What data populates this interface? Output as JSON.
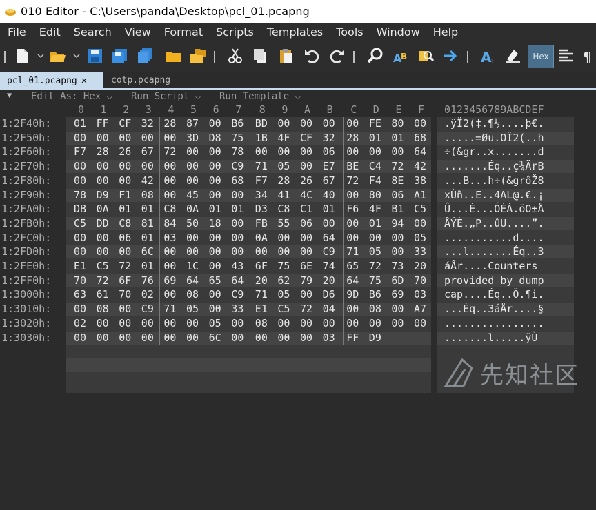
{
  "window": {
    "title": "010 Editor - C:\\Users\\panda\\Desktop\\pcl_01.pcapng"
  },
  "menu": [
    "File",
    "Edit",
    "Search",
    "View",
    "Format",
    "Scripts",
    "Templates",
    "Tools",
    "Window",
    "Help"
  ],
  "toolbar": {
    "hex_label": "Hex"
  },
  "tabs": [
    {
      "label": "pcl_01.pcapng",
      "close": "✕",
      "active": true
    },
    {
      "label": "cotp.pcapng",
      "active": false
    }
  ],
  "editbar": {
    "edit_as": "Edit As: Hex",
    "run_script": "Run Script",
    "run_template": "Run Template"
  },
  "columns": {
    "hex": [
      "0",
      "1",
      "2",
      "3",
      "4",
      "5",
      "6",
      "7",
      "8",
      "9",
      "A",
      "B",
      "C",
      "D",
      "E",
      "F"
    ],
    "text": "0123456789ABCDEF"
  },
  "rows": [
    {
      "addr": "1:2F40h:",
      "bytes": [
        "01",
        "FF",
        "CF",
        "32",
        "28",
        "87",
        "00",
        "B6",
        "BD",
        "00",
        "00",
        "00",
        "00",
        "FE",
        "80",
        "00"
      ],
      "text": ".ÿÏ2(‡.¶½....þ€."
    },
    {
      "addr": "1:2F50h:",
      "bytes": [
        "00",
        "00",
        "00",
        "00",
        "00",
        "3D",
        "D8",
        "75",
        "1B",
        "4F",
        "CF",
        "32",
        "28",
        "01",
        "01",
        "68"
      ],
      "text": ".....=Øu.OÏ2(..h"
    },
    {
      "addr": "1:2F60h:",
      "bytes": [
        "F7",
        "28",
        "26",
        "67",
        "72",
        "00",
        "00",
        "78",
        "00",
        "00",
        "00",
        "06",
        "00",
        "00",
        "00",
        "64"
      ],
      "text": "÷(&gr..x.......d"
    },
    {
      "addr": "1:2F70h:",
      "bytes": [
        "00",
        "00",
        "00",
        "00",
        "00",
        "00",
        "00",
        "C9",
        "71",
        "05",
        "00",
        "E7",
        "BE",
        "C4",
        "72",
        "42"
      ],
      "text": ".......Éq..ç¾ÄrB"
    },
    {
      "addr": "1:2F80h:",
      "bytes": [
        "00",
        "00",
        "00",
        "42",
        "00",
        "00",
        "00",
        "68",
        "F7",
        "28",
        "26",
        "67",
        "72",
        "F4",
        "8E",
        "38"
      ],
      "text": "...B...h÷(&grôŽ8"
    },
    {
      "addr": "1:2F90h:",
      "bytes": [
        "78",
        "D9",
        "F1",
        "08",
        "00",
        "45",
        "00",
        "00",
        "34",
        "41",
        "4C",
        "40",
        "00",
        "80",
        "06",
        "A1"
      ],
      "text": "xÙñ..E..4AL@.€.¡"
    },
    {
      "addr": "1:2FA0h:",
      "bytes": [
        "DB",
        "0A",
        "01",
        "01",
        "C8",
        "0A",
        "01",
        "01",
        "D3",
        "C8",
        "C1",
        "01",
        "F6",
        "4F",
        "B1",
        "C5"
      ],
      "text": "Û...È...ÓÈÁ.öO±Å"
    },
    {
      "addr": "1:2FB0h:",
      "bytes": [
        "C5",
        "DD",
        "C8",
        "81",
        "84",
        "50",
        "18",
        "00",
        "FB",
        "55",
        "06",
        "00",
        "00",
        "01",
        "94",
        "00"
      ],
      "text": "ÅÝÈ.„P..ûU....”."
    },
    {
      "addr": "1:2FC0h:",
      "bytes": [
        "00",
        "00",
        "06",
        "01",
        "03",
        "00",
        "00",
        "00",
        "0A",
        "00",
        "00",
        "64",
        "00",
        "00",
        "00",
        "05"
      ],
      "text": "...........d...."
    },
    {
      "addr": "1:2FD0h:",
      "bytes": [
        "00",
        "00",
        "00",
        "6C",
        "00",
        "00",
        "00",
        "00",
        "00",
        "00",
        "00",
        "C9",
        "71",
        "05",
        "00",
        "33"
      ],
      "text": "...l.......Éq..3"
    },
    {
      "addr": "1:2FE0h:",
      "bytes": [
        "E1",
        "C5",
        "72",
        "01",
        "00",
        "1C",
        "00",
        "43",
        "6F",
        "75",
        "6E",
        "74",
        "65",
        "72",
        "73",
        "20"
      ],
      "text": "áÅr....Counters "
    },
    {
      "addr": "1:2FF0h:",
      "bytes": [
        "70",
        "72",
        "6F",
        "76",
        "69",
        "64",
        "65",
        "64",
        "20",
        "62",
        "79",
        "20",
        "64",
        "75",
        "6D",
        "70"
      ],
      "text": "provided by dump"
    },
    {
      "addr": "1:3000h:",
      "bytes": [
        "63",
        "61",
        "70",
        "02",
        "00",
        "08",
        "00",
        "C9",
        "71",
        "05",
        "00",
        "D6",
        "9D",
        "B6",
        "69",
        "03"
      ],
      "text": "cap....Éq..Ö.¶i."
    },
    {
      "addr": "1:3010h:",
      "bytes": [
        "00",
        "08",
        "00",
        "C9",
        "71",
        "05",
        "00",
        "33",
        "E1",
        "C5",
        "72",
        "04",
        "00",
        "08",
        "00",
        "A7"
      ],
      "text": "...Éq..3áÅr....§"
    },
    {
      "addr": "1:3020h:",
      "bytes": [
        "02",
        "00",
        "00",
        "00",
        "00",
        "00",
        "05",
        "00",
        "08",
        "00",
        "00",
        "00",
        "00",
        "00",
        "00",
        "00"
      ],
      "text": "................"
    },
    {
      "addr": "1:3030h:",
      "bytes": [
        "00",
        "00",
        "00",
        "00",
        "00",
        "00",
        "6C",
        "00",
        "00",
        "00",
        "00",
        "03",
        "FF",
        "D9"
      ],
      "text": ".......l.....ÿÙ"
    }
  ],
  "watermark": {
    "text": "先知社区"
  },
  "colors": {
    "tab_active": "#c9dced",
    "hex_button": "#4a6f8c",
    "background": "#2b2b2b"
  }
}
